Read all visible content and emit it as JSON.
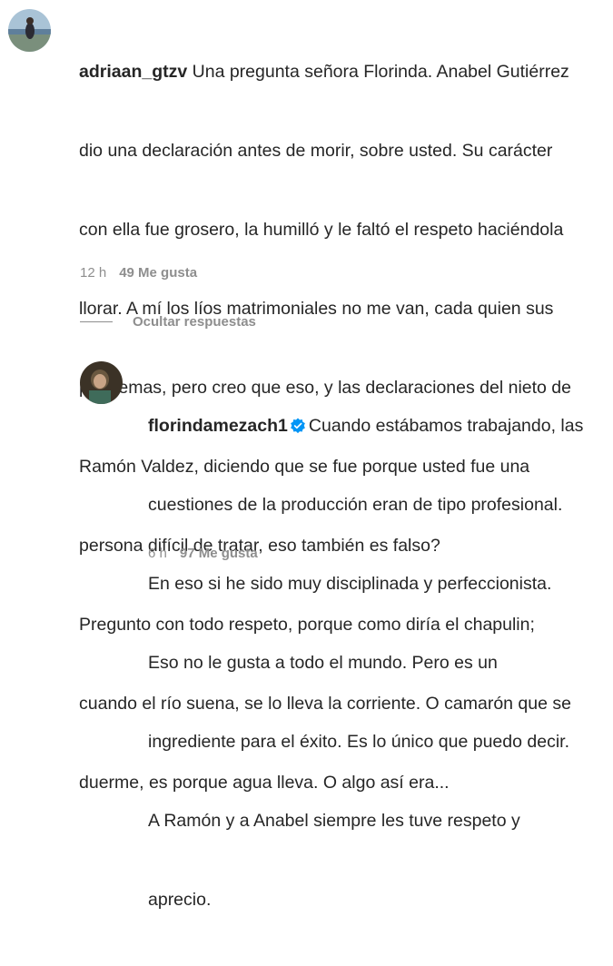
{
  "comment": {
    "username": "adriaan_gtzv",
    "text_first_line": "Una pregunta señora Florinda. Anabel Gutiérrez",
    "lines": [
      "dio una declaración antes de morir, sobre usted. Su carácter",
      "con ella fue grosero, la humilló y le faltó el respeto haciéndola",
      "llorar. A mí los líos matrimoniales no me van, cada quien sus",
      "problemas, pero creo que eso, y las declaraciones del nieto de",
      "Ramón Valdez, diciendo que se fue porque usted fue una",
      "persona difícil de tratar, eso también es falso?",
      "Pregunto con todo respeto, porque como diría el chapulin;",
      "cuando el río suena, se lo lleva la corriente. O camarón que se",
      "duerme, es porque agua lleva. O algo así era..."
    ],
    "time": "12 h",
    "likes": "49 Me gusta"
  },
  "hide_replies": "Ocultar respuestas",
  "reply": {
    "username": "florindamezach1",
    "verified_icon": "verified-badge-icon",
    "verified_color": "#0095f6",
    "text_first_line": "Cuando estábamos trabajando, las",
    "lines": [
      "cuestiones de la producción eran de tipo profesional.",
      "En eso si he sido muy disciplinada y perfeccionista.",
      "Eso no le gusta a todo el mundo. Pero es un",
      "ingrediente para el éxito. Es lo único que puedo decir.",
      "A Ramón y a Anabel siempre les tuve respeto y",
      "aprecio."
    ],
    "time": "6 h",
    "likes": "97 Me gusta"
  }
}
